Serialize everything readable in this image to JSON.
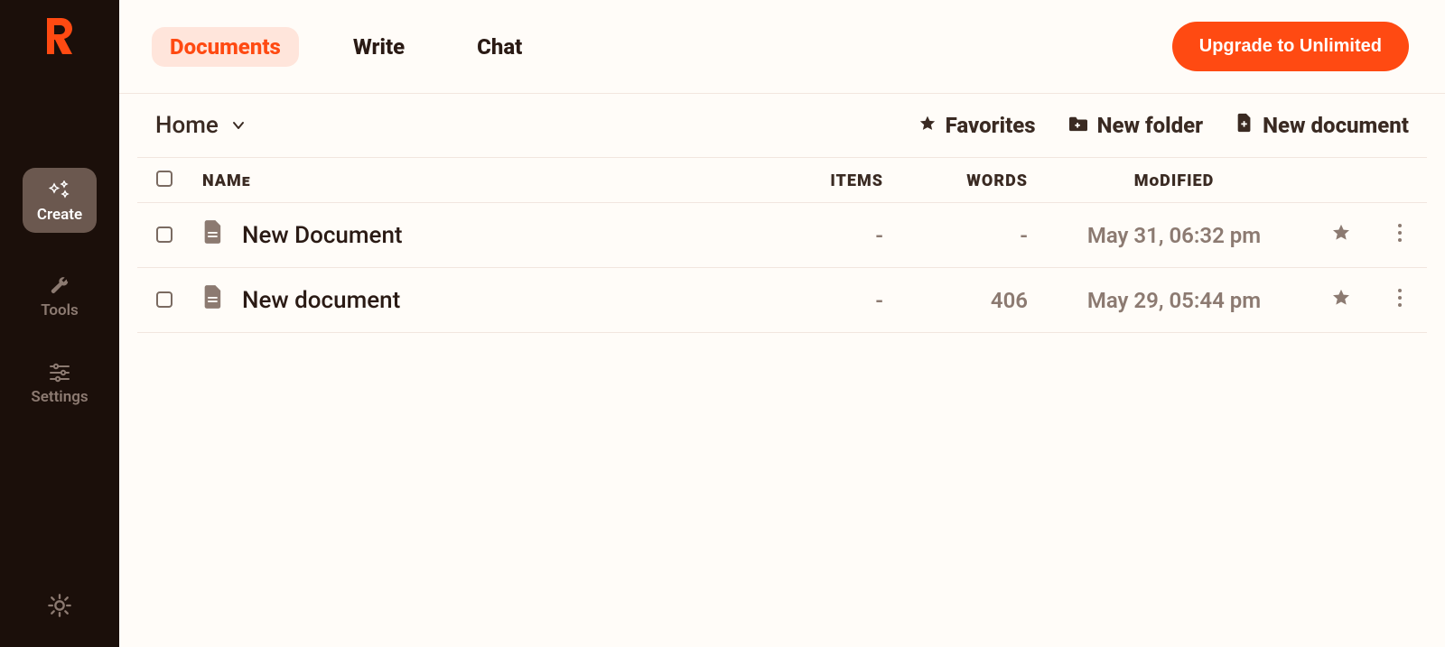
{
  "sidebar": {
    "items": [
      {
        "label": "Create"
      },
      {
        "label": "Tools"
      },
      {
        "label": "Settings"
      }
    ]
  },
  "header": {
    "tabs": [
      {
        "label": "Documents",
        "active": true
      },
      {
        "label": "Write",
        "active": false
      },
      {
        "label": "Chat",
        "active": false
      }
    ],
    "upgrade_label": "Upgrade to Unlimited"
  },
  "subbar": {
    "breadcrumb": "Home",
    "actions": {
      "favorites_label": "Favorites",
      "new_folder_label": "New folder",
      "new_document_label": "New document"
    }
  },
  "table": {
    "columns": {
      "name": "NAMe",
      "items": "ITEMS",
      "words": "WORDS",
      "modified": "MoDIFIED"
    },
    "rows": [
      {
        "name": "New Document",
        "items": "-",
        "words": "-",
        "modified": "May 31, 06:32 pm"
      },
      {
        "name": "New document",
        "items": "-",
        "words": "406",
        "modified": "May 29, 05:44 pm"
      }
    ]
  },
  "colors": {
    "accent": "#ff4a12",
    "sidebar_bg": "#1b0f0a"
  }
}
